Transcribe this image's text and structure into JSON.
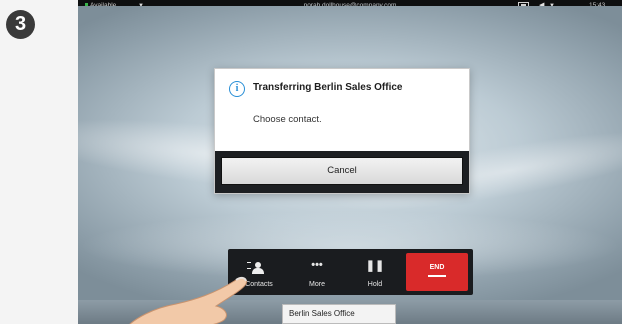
{
  "step": {
    "number": "3"
  },
  "status_bar": {
    "availability": "Available",
    "email": "norah.dollhouse@company.com",
    "time": "15:43",
    "icons": [
      "selfview-icon",
      "volume-icon",
      "chevron-down-icon"
    ]
  },
  "dialog": {
    "icon": "info-icon",
    "title": "Transferring Berlin Sales Office",
    "message": "Choose contact.",
    "cancel_label": "Cancel"
  },
  "call_controls": {
    "buttons": [
      {
        "label": "Contacts",
        "icon": "contacts-icon"
      },
      {
        "label": "More",
        "icon": "more-icon"
      },
      {
        "label": "Hold",
        "icon": "pause-icon"
      },
      {
        "label": "END",
        "icon": "end-call-icon"
      }
    ]
  },
  "active_call": {
    "name": "Berlin Sales Office"
  },
  "colors": {
    "end_button": "#d92a2a",
    "available_dot": "#39b54a",
    "info_blue": "#2a8fd6"
  }
}
